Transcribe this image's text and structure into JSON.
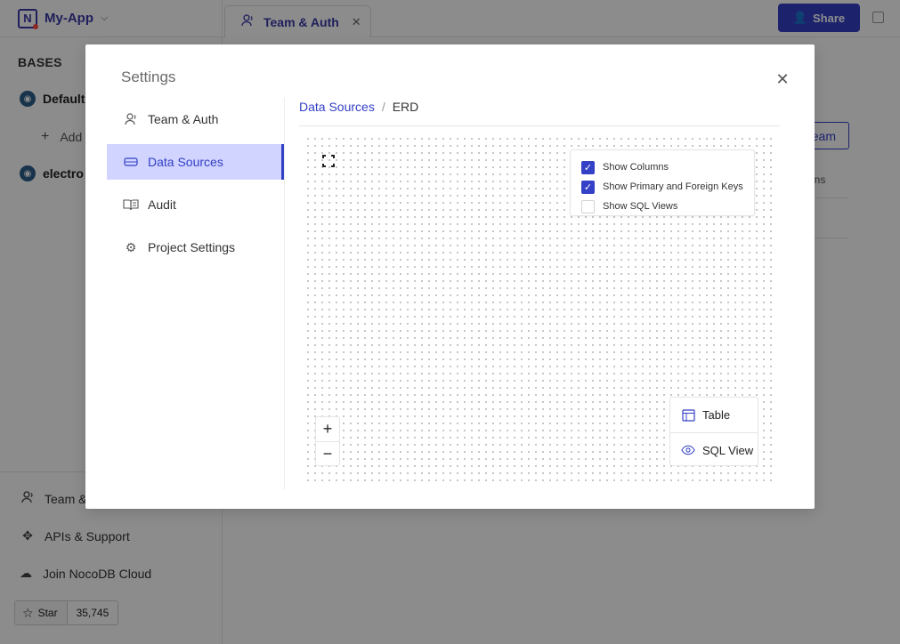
{
  "app": {
    "name": "My-App",
    "logo_letter": "N"
  },
  "sidebar": {
    "section_title": "BASES",
    "bases": [
      {
        "label": "Default"
      },
      {
        "label": "electro"
      }
    ],
    "add_label": "Add",
    "bottom": {
      "team_label": "Team &",
      "apis_label": "APIs & Support",
      "cloud_label": "Join NocoDB Cloud"
    },
    "github": {
      "star_label": "Star",
      "count": "35,745"
    }
  },
  "topbar": {
    "tab_label": "Team & Auth",
    "share_label": "Share"
  },
  "background": {
    "team_button_label": "eam",
    "options_text": "tions"
  },
  "modal": {
    "title": "Settings",
    "menu": [
      {
        "label": "Team & Auth"
      },
      {
        "label": "Data Sources",
        "active": true
      },
      {
        "label": "Audit"
      },
      {
        "label": "Project Settings"
      }
    ],
    "breadcrumb": {
      "parent": "Data Sources",
      "separator": "/",
      "current": "ERD"
    },
    "erd": {
      "options": [
        {
          "label": "Show Columns",
          "checked": true
        },
        {
          "label": "Show Primary and Foreign Keys",
          "checked": true
        },
        {
          "label": "Show SQL Views",
          "checked": false
        }
      ],
      "zoom_in": "+",
      "zoom_out": "−",
      "legend": [
        {
          "label": "Table",
          "icon": "table-icon"
        },
        {
          "label": "SQL View",
          "icon": "eye-icon"
        }
      ]
    }
  },
  "colors": {
    "accent": "#3440c5",
    "active_bg": "#d0d4ff",
    "overlay": "rgba(0,0,0,0.45)"
  }
}
